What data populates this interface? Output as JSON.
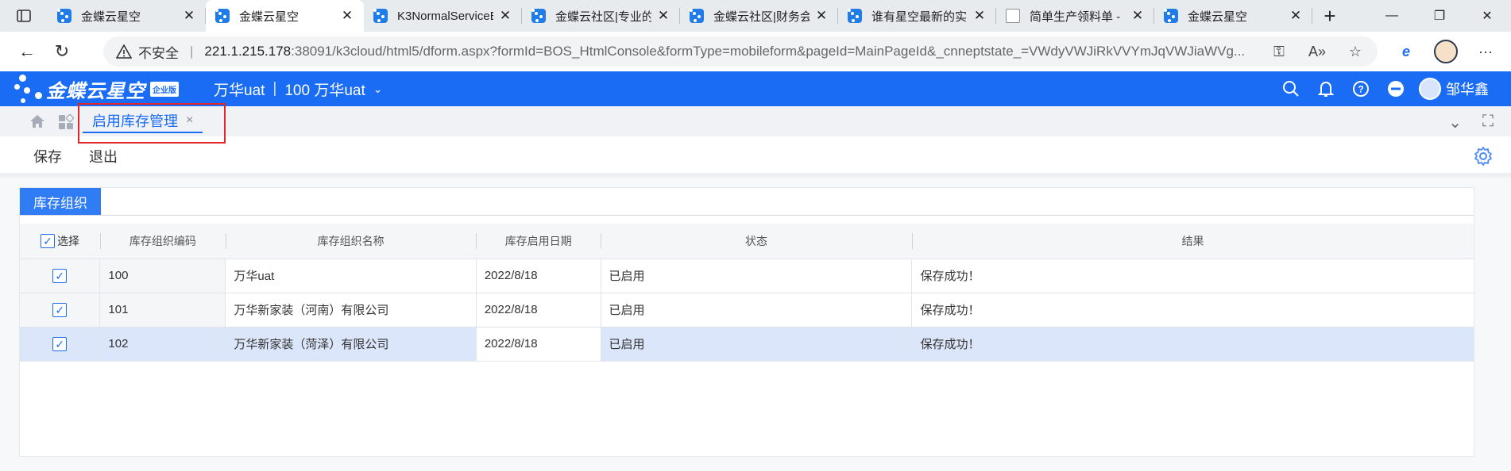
{
  "browser": {
    "tabs": [
      {
        "label": "金蝶云星空",
        "icon": "kingdee-favicon",
        "active": false
      },
      {
        "label": "金蝶云星空",
        "icon": "kingdee-favicon",
        "active": true
      },
      {
        "label": "K3NormalServiceE",
        "icon": "kingdee-favicon",
        "active": false
      },
      {
        "label": "金蝶云社区|专业的",
        "icon": "kingdee-favicon",
        "active": false
      },
      {
        "label": "金蝶云社区|财务会",
        "icon": "kingdee-favicon",
        "active": false
      },
      {
        "label": "谁有星空最新的实",
        "icon": "kingdee-favicon",
        "active": false
      },
      {
        "label": "简单生产领料单 -",
        "icon": "document-favicon",
        "active": false
      },
      {
        "label": "金蝶云星空",
        "icon": "kingdee-favicon",
        "active": false
      }
    ],
    "address": {
      "security_label": "不安全",
      "host": "221.1.215.178",
      "rest": ":38091/k3cloud/html5/dform.aspx?formId=BOS_HtmlConsole&formType=mobileform&pageId=MainPageId&_cnneptstate_=VWdyVWJiRkVVYmJqVWJiaWVg..."
    }
  },
  "app": {
    "brand": "金蝶云星空",
    "edition_badge": "企业版",
    "org_name": "万华uat",
    "org_separator": "|",
    "org_current": "100 万华uat",
    "user_name": "邹华鑫",
    "brand_color": "#1a6cf5"
  },
  "page_tab": {
    "label": "启用库存管理",
    "close": "×"
  },
  "toolbar": {
    "save_label": "保存",
    "exit_label": "退出"
  },
  "panel": {
    "tab_label": "库存组织",
    "columns": {
      "select": "选择",
      "org_code": "库存组织编码",
      "org_name": "库存组织名称",
      "enable_date": "库存启用日期",
      "status": "状态",
      "result": "结果"
    },
    "rows": [
      {
        "checked": "✓",
        "code": "100",
        "name": "万华uat",
        "date": "2022/8/18",
        "status": "已启用",
        "result": "保存成功！"
      },
      {
        "checked": "✓",
        "code": "101",
        "name": "万华新家装（河南）有限公司",
        "date": "2022/8/18",
        "status": "已启用",
        "result": "保存成功！"
      },
      {
        "checked": "✓",
        "code": "102",
        "name": "万华新家装（菏泽）有限公司",
        "date": "2022/8/18",
        "status": "已启用",
        "result": "保存成功！"
      }
    ]
  }
}
